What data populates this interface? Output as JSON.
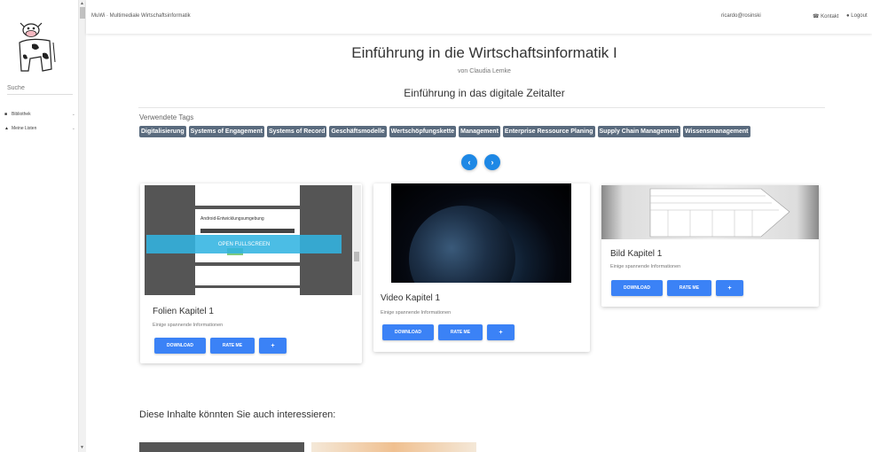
{
  "app": {
    "title": "MuWi · Multimediale Wirtschaftsinformatik"
  },
  "header": {
    "user": "ricardo@rosinski",
    "kontakt": "Kontakt",
    "logout": "Logout"
  },
  "sidebar": {
    "search_placeholder": "Suche",
    "items": [
      {
        "label": "Bibliothek",
        "icon": "book-icon"
      },
      {
        "label": "Meine Listen",
        "icon": "graduation-cap-icon"
      }
    ]
  },
  "course": {
    "title": "Einführung in die Wirtschaftsinformatik I",
    "author": "von Claudia Lemke",
    "chapter": "Einführung in das digitale Zeitalter"
  },
  "tags": {
    "label": "Verwendete Tags",
    "items": [
      "Digitalisierung",
      "Systems of Engagement",
      "Systems of Record",
      "Geschäftsmodelle",
      "Wertschöpfungskette",
      "Management",
      "Enterprise Ressource Planing",
      "Supply Chain Management",
      "Wissensmanagement"
    ]
  },
  "nav": {
    "prev": "‹",
    "next": "›"
  },
  "cards": [
    {
      "title": "Folien Kapitel 1",
      "desc": "Einige spannende Informationen",
      "overlay": "OPEN FULLSCREEN",
      "pdf_heading": "Android-Entwicklungsumgebung"
    },
    {
      "title": "Video Kapitel 1",
      "desc": "Einige spannende Informationen"
    },
    {
      "title": "Bild Kapitel 1",
      "desc": "Einige spannende Informationen"
    }
  ],
  "buttons": {
    "download": "DOWNLOAD",
    "rate": "RATE ME",
    "plus": "+"
  },
  "recommend": {
    "title": "Diese Inhalte könnten Sie auch interessieren:"
  },
  "colors": {
    "accent": "#3b82f6",
    "tag": "#5a6b7e",
    "nav_circle": "#1e88e5",
    "overlay": "#32b4e1"
  }
}
